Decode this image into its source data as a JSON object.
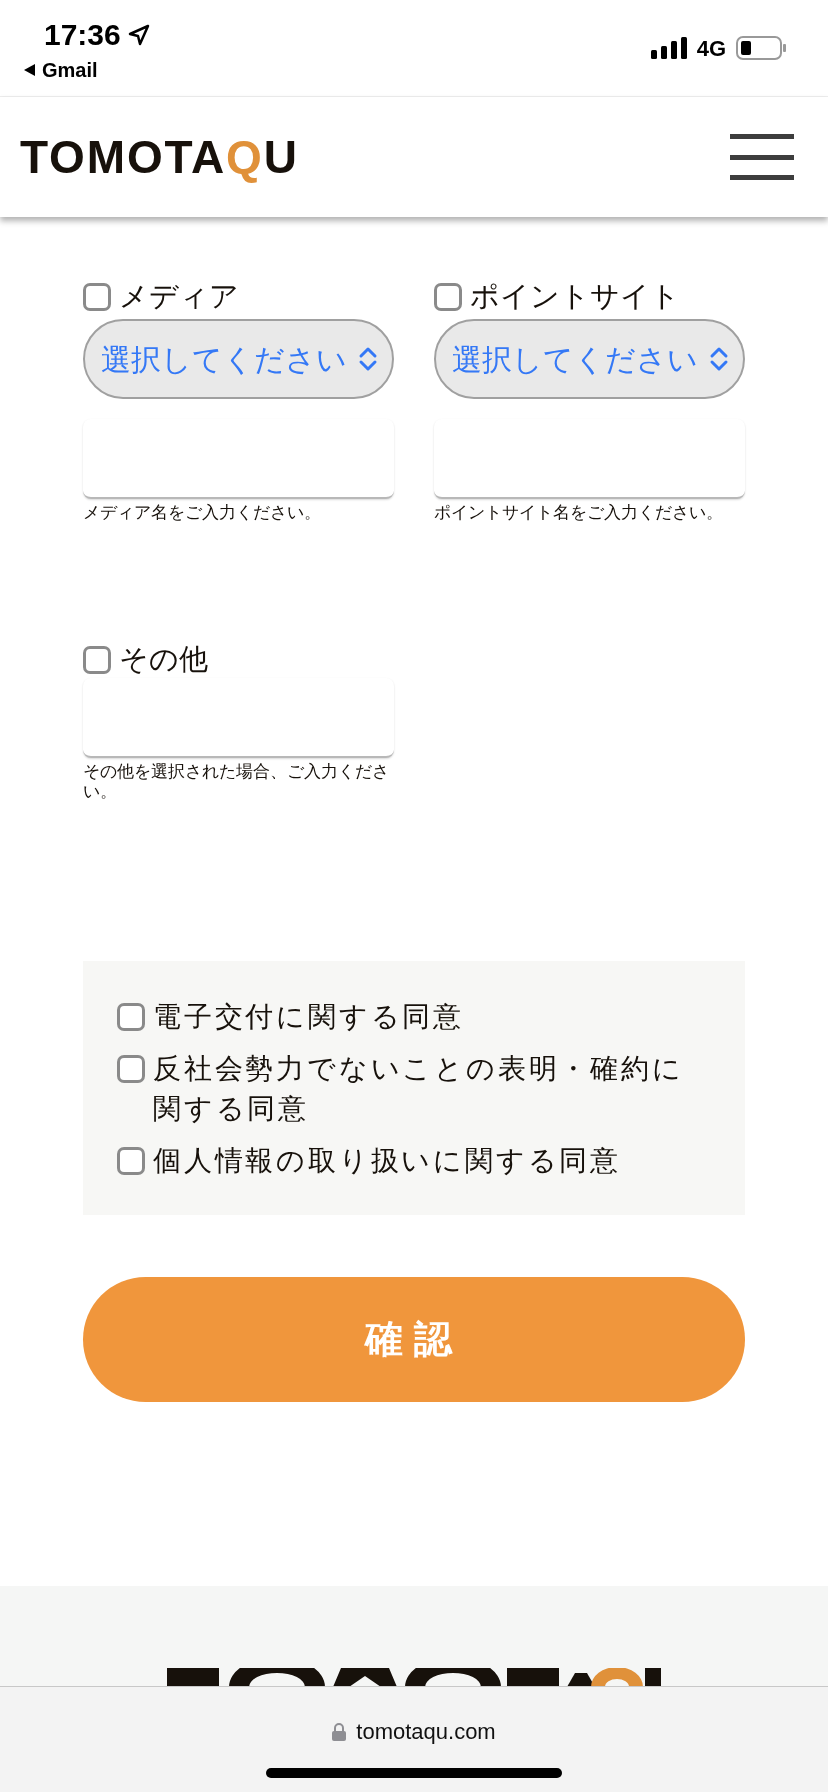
{
  "status_bar": {
    "time": "17:36",
    "back_app": "Gmail",
    "network": "4G"
  },
  "header": {
    "logo": [
      {
        "text": "TOMOTA",
        "accent": false
      },
      {
        "text": "Q",
        "accent": true
      },
      {
        "text": "U",
        "accent": false
      }
    ]
  },
  "media_fields": [
    {
      "label": "メディア",
      "checked": false,
      "select_value": "選択してください",
      "help": "メディア名をご入力ください。"
    },
    {
      "label": "ポイントサイト",
      "checked": false,
      "select_value": "選択してください",
      "help": "ポイントサイト名をご入力ください。"
    }
  ],
  "other_field": {
    "label": "その他",
    "checked": false,
    "help": "その他を選択された場合、ご入力ください。"
  },
  "consents": [
    {
      "label": "電子交付に関する同意",
      "checked": false
    },
    {
      "label": "反社会勢力でないことの表明・確約に関する同意",
      "checked": false
    },
    {
      "label": "個人情報の取り扱いに関する同意",
      "checked": false
    }
  ],
  "submit_button": "確認",
  "url_bar": {
    "url": "tomotaqu.com"
  }
}
